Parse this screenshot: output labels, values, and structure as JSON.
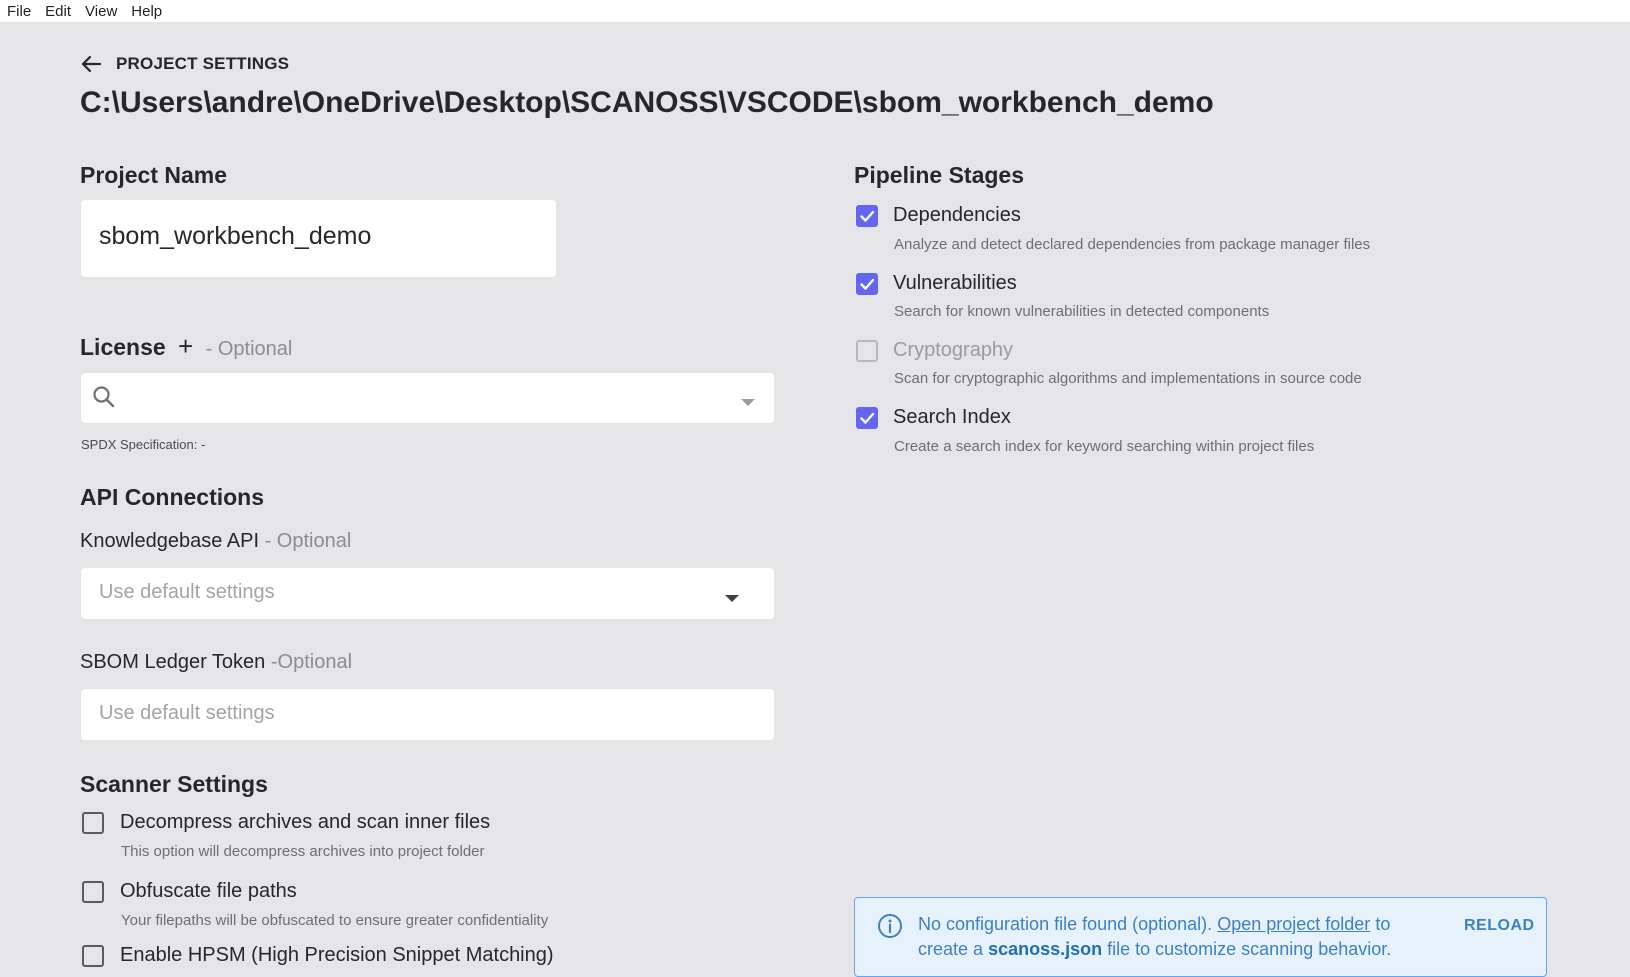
{
  "menu": {
    "items": [
      "File",
      "Edit",
      "View",
      "Help"
    ]
  },
  "header": {
    "section": "PROJECT SETTINGS",
    "path": "C:\\Users\\andre\\OneDrive\\Desktop\\SCANOSS\\VSCODE\\sbom_workbench_demo"
  },
  "project_name": {
    "label": "Project Name",
    "value": "sbom_workbench_demo"
  },
  "license": {
    "label": "License",
    "add": "+",
    "optional": "- Optional",
    "search_value": "",
    "spdx": "SPDX Specification:  -"
  },
  "api": {
    "title": "API Connections",
    "kb_label": "Knowledgebase API",
    "kb_optional": "- Optional",
    "kb_value": "Use default settings",
    "ledger_label": "SBOM Ledger Token",
    "ledger_optional": "-Optional",
    "ledger_placeholder": "Use default settings"
  },
  "scanner": {
    "title": "Scanner Settings",
    "options": [
      {
        "label": "Decompress archives and scan inner files",
        "desc": "This option will decompress archives into project folder",
        "checked": false
      },
      {
        "label": "Obfuscate file paths",
        "desc": "Your filepaths will be obfuscated to ensure greater confidentiality",
        "checked": false
      },
      {
        "label": "Enable HPSM (High Precision Snippet Matching)",
        "checked": false
      }
    ]
  },
  "pipeline": {
    "title": "Pipeline Stages",
    "stages": [
      {
        "label": "Dependencies",
        "desc": "Analyze and detect declared dependencies from package manager files",
        "checked": true
      },
      {
        "label": "Vulnerabilities",
        "desc": "Search for known vulnerabilities in detected components",
        "checked": true
      },
      {
        "label": "Cryptography",
        "desc": "Scan for cryptographic algorithms and implementations in source code",
        "checked": false,
        "disabled": true
      },
      {
        "label": "Search Index",
        "desc": "Create a search index for keyword searching within project files",
        "checked": true
      }
    ]
  },
  "info": {
    "text1": "No configuration file found (optional).",
    "link": "Open project folder",
    "text2": "to create a",
    "file": "scanoss.json",
    "text3": "file to customize scanning behavior.",
    "action": "RELOAD"
  },
  "colors": {
    "accent": "#6366f1",
    "info": "#3b82c4",
    "background": "#e5e5e8"
  }
}
